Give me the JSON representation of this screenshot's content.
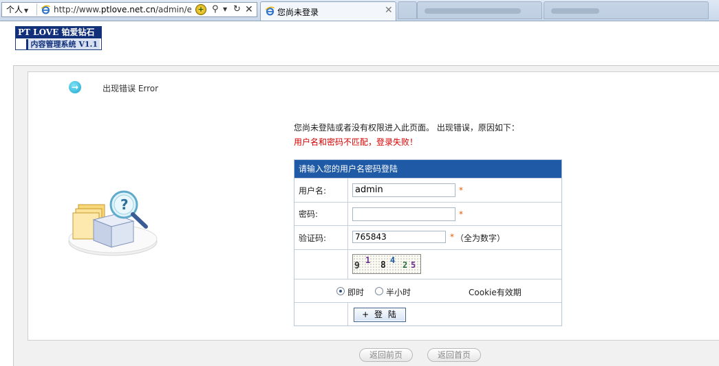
{
  "browser": {
    "persona_label": "个人",
    "url_prefix": "http://www.",
    "url_host": "ptlove.net.cn",
    "url_rest": "/admin/err",
    "active_tab_title": "您尚未登录"
  },
  "logo": {
    "line1": "PT LOVE 铂爱钻石",
    "line2": "内容管理系统 V1.1"
  },
  "error": {
    "title": "出现错误  Error",
    "message": "您尚未登陆或者没有权限进入此页面。 出现错误，原因如下：",
    "reason": "用户名和密码不匹配，登录失败！"
  },
  "login": {
    "header": "请输入您的用户名密码登陆",
    "username_label": "用户名:",
    "username_value": "admin",
    "password_label": "密码:",
    "password_value": "",
    "captcha_label": "验证码:",
    "captcha_value": "765843",
    "required_mark": "*",
    "captcha_hint": "（全为数字）",
    "captcha_digits": [
      "9",
      "1",
      "8",
      "4",
      "2",
      "5"
    ],
    "radio_now": "即时",
    "radio_half_hour": "半小时",
    "radio_selected": "即时",
    "cookie_label": "Cookie有效期",
    "submit_label": "+ 登 陆"
  },
  "footer": {
    "back_label": "返回前页",
    "home_label": "返回首页"
  },
  "colors": {
    "header_blue": "#1f5aa6",
    "error_red": "#d60000",
    "required_orange": "#e35a00",
    "logo_navy": "#12307a"
  }
}
